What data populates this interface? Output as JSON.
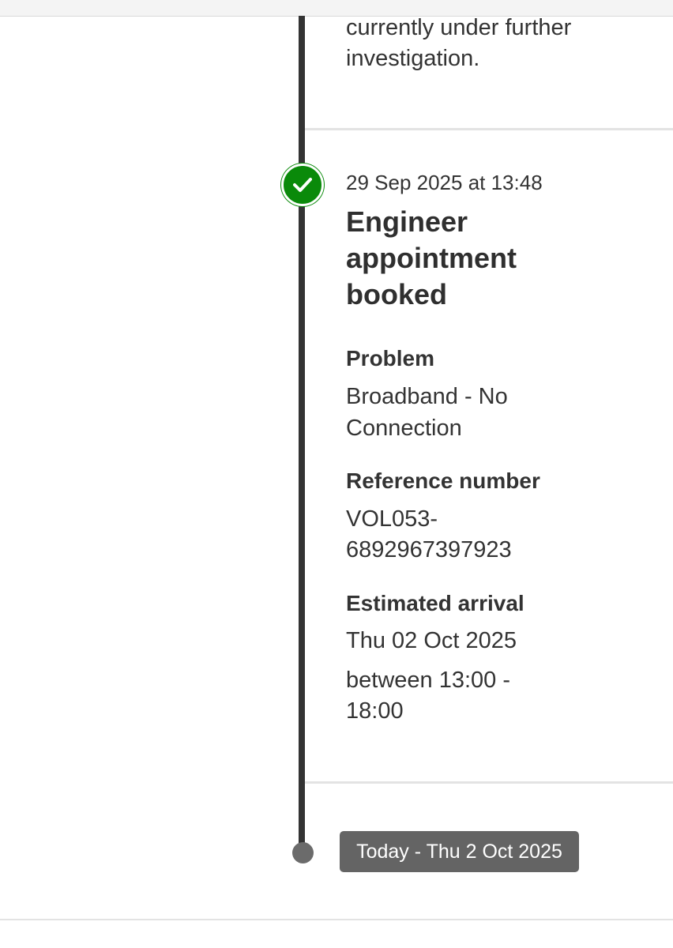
{
  "previous_event": {
    "description_line1": "currently under further",
    "description_line2": "investigation."
  },
  "event": {
    "timestamp": "29 Sep 2025 at 13:48",
    "title_line1": "Engineer",
    "title_line2": "appointment",
    "title_line3": "booked",
    "problem_label": "Problem",
    "problem_line1": "Broadband - No",
    "problem_line2": "Connection",
    "reference_label": "Reference number",
    "reference_line1": "VOL053-",
    "reference_line2": "6892967397923",
    "arrival_label": "Estimated arrival",
    "arrival_date": "Thu 02 Oct 2025",
    "arrival_window_line1": "between 13:00 -",
    "arrival_window_line2": "18:00",
    "status_icon": "check-icon",
    "status_color": "#0a8a0a"
  },
  "today": {
    "label": "Today - Thu 2 Oct 2025"
  }
}
